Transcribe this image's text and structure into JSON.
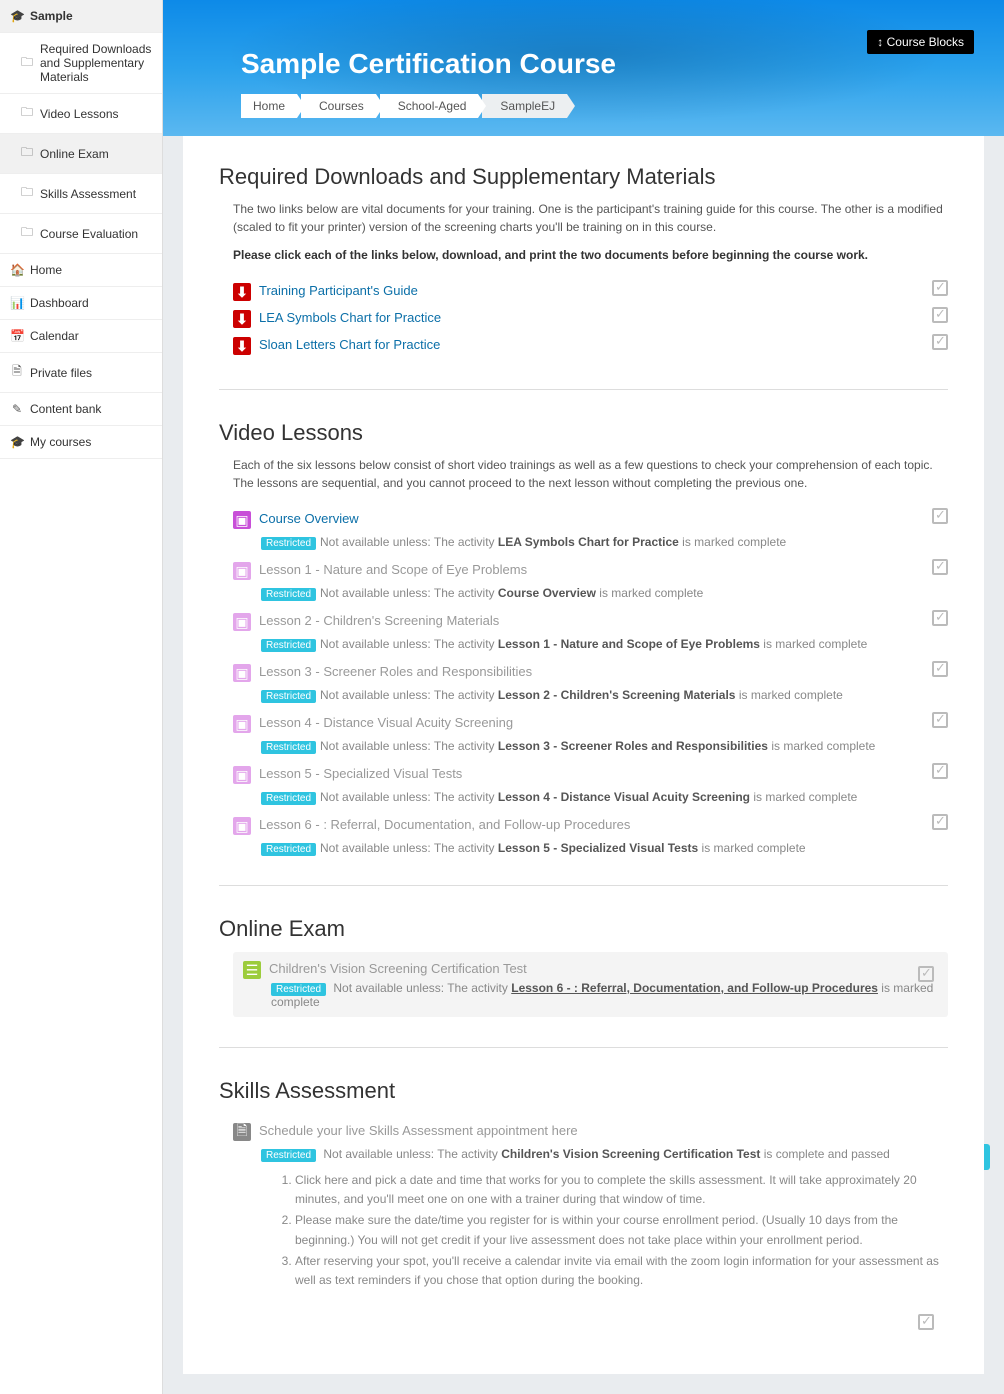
{
  "sidebar": {
    "course": "Sample",
    "sections": [
      "Required Downloads and Supplementary Materials",
      "Video Lessons",
      "Online Exam",
      "Skills Assessment",
      "Course Evaluation"
    ],
    "nav": [
      "Home",
      "Dashboard",
      "Calendar",
      "Private files",
      "Content bank",
      "My courses"
    ]
  },
  "header": {
    "course_blocks": "Course Blocks",
    "title": "Sample Certification Course",
    "breadcrumb": [
      "Home",
      "Courses",
      "School-Aged",
      "SampleEJ"
    ]
  },
  "sections": {
    "downloads": {
      "title": "Required Downloads and Supplementary Materials",
      "intro1": "The two links below are vital documents for your training.  One is the participant's training guide for this course.  The other is a modified (scaled to fit your printer) version of the screening charts you'll be training on in this course.",
      "intro2": "Please click each of the links below, download, and print the two documents before beginning the course work.",
      "items": [
        "Training Participant's Guide",
        "LEA Symbols Chart for Practice",
        "Sloan Letters Chart for Practice"
      ]
    },
    "videos": {
      "title": "Video Lessons",
      "intro": "Each of the six lessons below consist of short video trainings as well as a few questions to check your comprehension of each topic.  The lessons are sequential, and you cannot proceed to the next lesson without completing the previous one.",
      "restricted_label": "Restricted",
      "na_prefix": "Not available unless: The activity ",
      "na_suffix": " is marked complete",
      "items": [
        {
          "label": "Course Overview",
          "locked": false,
          "prereq": "LEA Symbols Chart for Practice"
        },
        {
          "label": "Lesson 1 - Nature and Scope of Eye Problems",
          "locked": true,
          "prereq": "Course Overview"
        },
        {
          "label": "Lesson 2 - Children's Screening Materials",
          "locked": true,
          "prereq": "Lesson 1 - Nature and Scope of Eye Problems"
        },
        {
          "label": "Lesson 3 - Screener Roles and Responsibilities",
          "locked": true,
          "prereq": "Lesson 2 - Children's Screening Materials"
        },
        {
          "label": "Lesson 4 - Distance Visual Acuity Screening",
          "locked": true,
          "prereq": "Lesson 3 - Screener Roles and Responsibilities"
        },
        {
          "label": "Lesson 5 - Specialized Visual Tests",
          "locked": true,
          "prereq": "Lesson 4 - Distance Visual Acuity Screening"
        },
        {
          "label": "Lesson 6 - : Referral, Documentation, and Follow-up Procedures",
          "locked": true,
          "prereq": "Lesson 5 - Specialized Visual Tests"
        }
      ]
    },
    "exam": {
      "title": "Online Exam",
      "item": "Children's Vision Screening Certification Test",
      "prereq": "Lesson 6 - : Referral, Documentation, and Follow-up Procedures"
    },
    "skills": {
      "title": "Skills Assessment",
      "item": "Schedule your live Skills Assessment appointment here",
      "na_prefix": "Not available unless: The activity ",
      "prereq": "Children's Vision Screening Certification Test",
      "na_suffix": " is complete and passed",
      "notes": [
        "Click here and pick a date and time that works for you to complete the skills assessment.  It will take approximately 20 minutes, and you'll meet one on one with a trainer during that window of time.",
        "Please make sure the date/time you register for is within your course enrollment period. (Usually 10 days from the beginning.)  You will not get credit if your live assessment does not take place within your enrollment period.",
        "After reserving your spot, you'll receive a calendar invite via email with the zoom login information for your assessment as well as text reminders if you chose that option during the booking."
      ]
    }
  }
}
